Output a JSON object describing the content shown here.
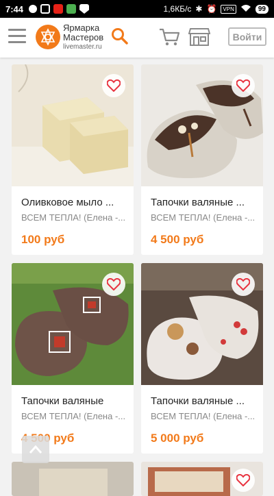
{
  "status": {
    "time": "7:44",
    "speed": "1,6КБ/с",
    "vpn": "VPN",
    "battery": "99"
  },
  "header": {
    "logo_line1": "Ярмарка",
    "logo_line2": "Мастеров",
    "logo_line3": "livemaster.ru",
    "login_label": "Войти"
  },
  "products": [
    {
      "title": "Оливковое мыло ...",
      "seller": "ВСЕМ ТЕПЛА! (Елена -...",
      "price": "100 руб",
      "image": "soap"
    },
    {
      "title": "Тапочки валяные ...",
      "seller": "ВСЕМ ТЕПЛА! (Елена -...",
      "price": "4 500 руб",
      "image": "slippers-grey"
    },
    {
      "title": "Тапочки валяные",
      "seller": "ВСЕМ ТЕПЛА! (Елена -...",
      "price": "4 500 руб",
      "image": "slippers-brown"
    },
    {
      "title": "Тапочки валяные ...",
      "seller": "ВСЕМ ТЕПЛА! (Елена -...",
      "price": "5 000 руб",
      "image": "slippers-white"
    }
  ],
  "colors": {
    "accent": "#f27a1a",
    "heart": "#e8333f"
  }
}
